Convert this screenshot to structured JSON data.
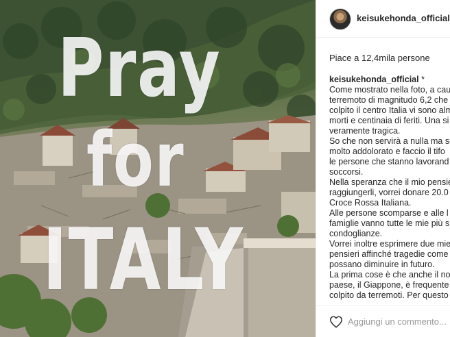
{
  "photo": {
    "overlay_line1": "Pray",
    "overlay_line2": "for",
    "overlay_line3": "ITALY"
  },
  "post": {
    "username": "keisukehonda_official",
    "likes": "Piace a 12,4mila persone",
    "caption_author": "keisukehonda_official",
    "caption_lines": [
      "Come mostrato nella foto, a cau",
      "terremoto di magnitudo 6,2 che",
      "colpito il centro Italia vi sono alm",
      "morti e centinaia di feriti. Una si",
      "veramente tragica.",
      "So che non servirà a nulla ma so",
      "molto addolorato e faccio il tifo",
      "le persone che stanno lavorand",
      "soccorsi.",
      "Nella speranza che il mio pensie",
      "raggiungerli, vorrei donare 20.0",
      "Croce Rossa Italiana.",
      "Alle persone scomparse e alle l",
      "famiglie vanno tutte le mie più s",
      "condoglianze.",
      "Vorrei inoltre esprimere due mie",
      "pensieri affinché tragedie come",
      "possano diminuire in futuro.",
      "La prima cose è che anche il no",
      "paese, il Giappone, è frequente",
      "colpito da terremoti. Per questo"
    ],
    "comment_placeholder": "Aggiungi un commento..."
  },
  "colors": {
    "text": "#262626",
    "muted": "#999999",
    "border": "#efefef"
  },
  "icons": {
    "like": "heart-icon"
  }
}
